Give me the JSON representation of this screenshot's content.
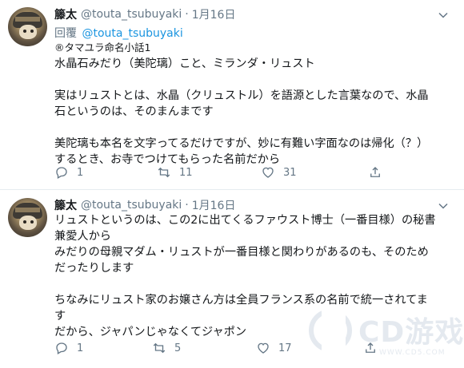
{
  "tweets": [
    {
      "author_name": "籐太",
      "handle": "@touta_tsubuyaki",
      "separator": "·",
      "date": "1月16日",
      "reply_prefix": "回覆",
      "reply_to": "@touta_tsubuyaki",
      "lines": [
        "®タマユラ命名小話1",
        "水晶石みだり（美陀璃）こと、ミランダ・リュスト",
        "",
        "実はリュストとは、水晶（クリュストル）を語源とした言葉なので、水晶",
        "石というのは、そのまんまです",
        "",
        "美陀璃も本名を文字ってるだけですが、妙に有難い字面なのは帰化（？）",
        "するとき、お寺でつけてもらった名前だから"
      ],
      "replies": "1",
      "retweets": "11",
      "likes": "31"
    },
    {
      "author_name": "籐太",
      "handle": "@touta_tsubuyaki",
      "separator": "·",
      "date": "1月16日",
      "lines": [
        "リュストというのは、この2に出てくるファウスト博士（一番目様）の秘書",
        "兼愛人から",
        "みだりの母親マダム・リュストが一番目様と関わりがあるのも、そのため",
        "だったりします",
        "",
        "ちなみにリュスト家のお嬢さん方は全員フランス系の名前で統一されてま",
        "す",
        "だから、ジャパンじゃなくてジャポン"
      ],
      "replies": "1",
      "retweets": "5",
      "likes": "17"
    }
  ],
  "watermark": {
    "title": "CD游戏",
    "url": "WWW.CD5.COM"
  },
  "colors": {
    "text": "#14171a",
    "secondary": "#657786",
    "link": "#1b95e0",
    "divider": "#e6ecf0"
  },
  "icons": [
    "chevron-down-icon",
    "reply-icon",
    "retweet-icon",
    "like-icon",
    "share-icon"
  ]
}
